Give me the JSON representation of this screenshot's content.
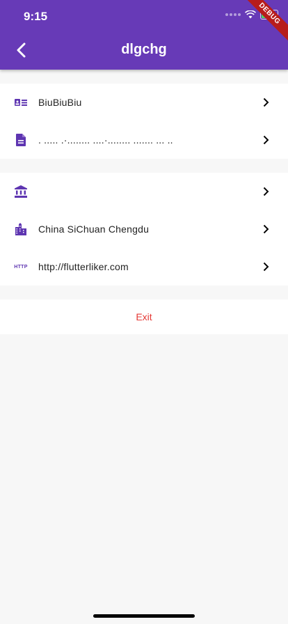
{
  "status": {
    "time": "9:15"
  },
  "debug_label": "DEBUG",
  "appbar": {
    "title": "dlgchg"
  },
  "section1": [
    {
      "label": "BiuBiuBiu",
      "icon": "id-card-icon"
    },
    {
      "label": ". ..... .·........ ....·........ ....... ... ..",
      "icon": "document-icon"
    }
  ],
  "section2": [
    {
      "label": "",
      "icon": "bank-icon"
    },
    {
      "label": "China SiChuan Chengdu",
      "icon": "city-icon"
    },
    {
      "label": "http://flutterliker.com",
      "icon": "http-icon",
      "icon_text": "HTTP"
    }
  ],
  "exit_label": "Exit",
  "colors": {
    "primary": "#673ab7",
    "icon": "#5e35b1",
    "exit": "#e53935",
    "debug": "#b71c1c"
  }
}
